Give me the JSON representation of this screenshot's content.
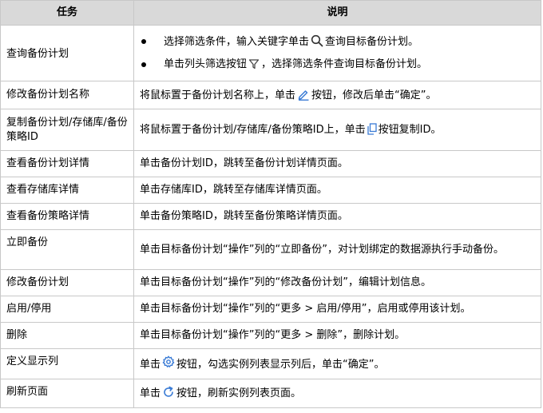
{
  "colors": {
    "header_bg": "#d9d9d9",
    "border": "#c8c8c8",
    "icon_blue": "#3a7bd5"
  },
  "header": {
    "col_task": "任务",
    "col_desc": "说明"
  },
  "rows": [
    {
      "task": "查询备份计划",
      "bullets": [
        {
          "pre": "选择筛选条件，输入关键字单击",
          "icon": "search-icon",
          "post": "查询目标备份计划。"
        },
        {
          "pre": "单击列头筛选按钮",
          "icon": "filter-icon",
          "post": "，选择筛选条件查询目标备份计划。"
        }
      ]
    },
    {
      "task": "修改备份计划名称",
      "pre": "将鼠标置于备份计划名称上，单击",
      "icon": "edit-icon",
      "post": "按钮，修改后单击“确定”。"
    },
    {
      "task": "复制备份计划/存储库/备份策略ID",
      "pre": "将鼠标置于备份计划/存储库/备份策略ID上，单击",
      "icon": "copy-icon",
      "post": "按钮复制ID。"
    },
    {
      "task": "查看备份计划详情",
      "text": "单击备份计划ID，跳转至备份计划详情页面。"
    },
    {
      "task": "查看存储库详情",
      "text": "单击存储库ID，跳转至存储库详情页面。"
    },
    {
      "task": "查看备份策略详情",
      "text": "单击备份策略ID，跳转至备份策略详情页面。"
    },
    {
      "task": "立即备份",
      "text": "单击目标备份计划“操作”列的“立即备份”，对计划绑定的数据源执行手动备份。"
    },
    {
      "task": "修改备份计划",
      "text": "单击目标备份计划“操作”列的“修改备份计划”，编辑计划信息。"
    },
    {
      "task": "启用/停用",
      "text": "单击目标备份计划“操作”列的“更多 > 启用/停用”，启用或停用该计划。"
    },
    {
      "task": "删除",
      "text": "单击目标备份计划“操作”列的“更多 > 删除”，删除计划。"
    },
    {
      "task": "定义显示列",
      "pre": "单击",
      "icon": "gear-icon",
      "post": "按钮，勾选实例列表显示列后，单击“确定”。"
    },
    {
      "task": "刷新页面",
      "pre": "单击",
      "icon": "refresh-icon",
      "post": "按钮，刷新实例列表页面。"
    }
  ]
}
